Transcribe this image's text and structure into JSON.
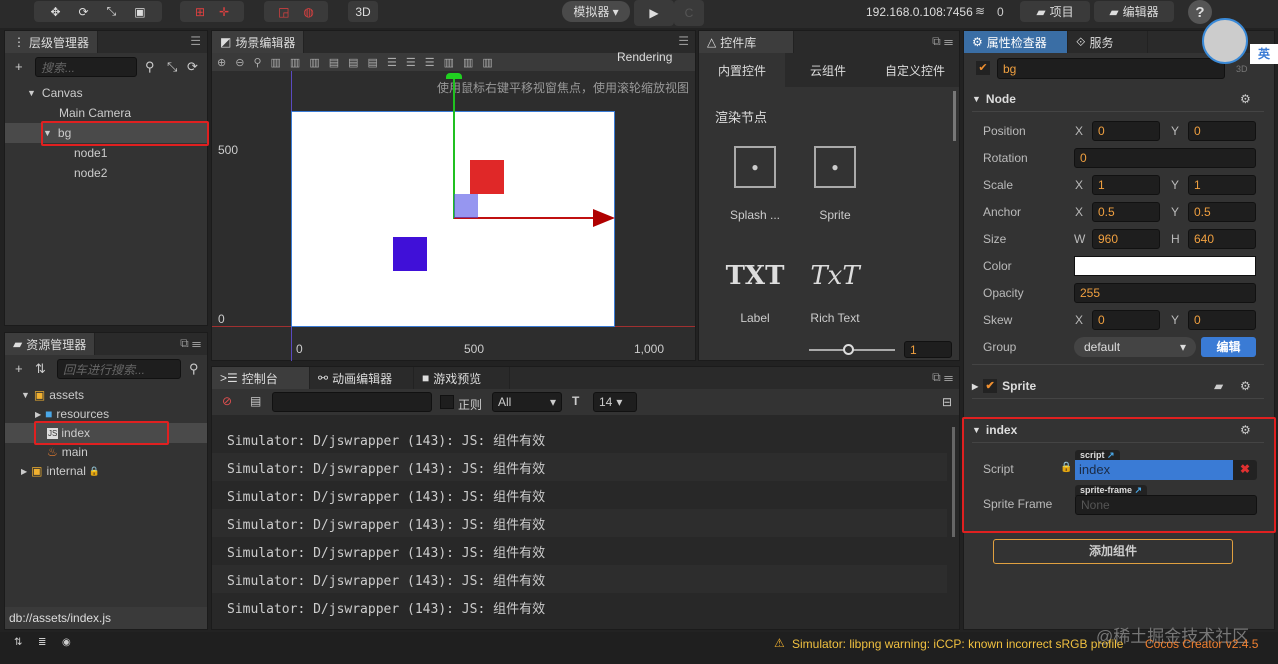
{
  "toolbar": {
    "simulator_label": "模拟器 ▾",
    "mode_3d": "3D",
    "ip": "192.168.0.108:7456",
    "connections": "0",
    "project_btn": "项目",
    "editor_btn": "编辑器",
    "help": "?",
    "ime": "英"
  },
  "hierarchy": {
    "title": "层级管理器",
    "search_placeholder": "搜索...",
    "items": [
      {
        "label": "Canvas"
      },
      {
        "label": "Main Camera"
      },
      {
        "label": "bg"
      },
      {
        "label": "node1"
      },
      {
        "label": "node2"
      }
    ]
  },
  "assets": {
    "title": "资源管理器",
    "search_placeholder": "回车进行搜索...",
    "items": [
      {
        "label": "assets"
      },
      {
        "label": "resources"
      },
      {
        "label": "index"
      },
      {
        "label": "main"
      },
      {
        "label": "internal"
      }
    ],
    "path": "db://assets/index.js"
  },
  "scene": {
    "title": "场景编辑器",
    "rendering": "Rendering",
    "hint": "使用鼠标右键平移视窗焦点，使用滚轮缩放视图",
    "y_ticks": [
      "500",
      "0"
    ],
    "x_ticks": [
      "0",
      "500",
      "1,000"
    ]
  },
  "widgets": {
    "title": "控件库",
    "tabs": [
      "内置控件",
      "云组件",
      "自定义控件"
    ],
    "section": "渲染节点",
    "items": [
      {
        "label": "Splash ...",
        "icon": "sprite-splash-icon"
      },
      {
        "label": "Sprite",
        "icon": "sprite-icon"
      },
      {
        "label": "Label",
        "icon": "TXT"
      },
      {
        "label": "Rich Text",
        "icon": "TxT"
      }
    ],
    "zoom_value": "1"
  },
  "console": {
    "tabs": [
      "控制台",
      "动画编辑器",
      "游戏预览"
    ],
    "regex_label": "正则",
    "filter": "All",
    "font_size": "14",
    "lines": [
      "Simulator: D/jswrapper (143): JS: 组件有效",
      "Simulator: D/jswrapper (143): JS: 组件有效",
      "Simulator: D/jswrapper (143): JS: 组件有效",
      "Simulator: D/jswrapper (143): JS: 组件有效",
      "Simulator: D/jswrapper (143): JS: 组件有效",
      "Simulator: D/jswrapper (143): JS: 组件有效",
      "Simulator: D/jswrapper (143): JS: 组件有效"
    ]
  },
  "inspector": {
    "title": "属性检查器",
    "service_tab": "服务",
    "node_name": "bg",
    "label_3d": "3D",
    "node_section": "Node",
    "position": {
      "label": "Position",
      "x": "0",
      "y": "0"
    },
    "rotation": {
      "label": "Rotation",
      "value": "0"
    },
    "scale": {
      "label": "Scale",
      "x": "1",
      "y": "1"
    },
    "anchor": {
      "label": "Anchor",
      "x": "0.5",
      "y": "0.5"
    },
    "size": {
      "label": "Size",
      "w": "960",
      "h": "640"
    },
    "color": {
      "label": "Color",
      "value": "#ffffff"
    },
    "opacity": {
      "label": "Opacity",
      "value": "255"
    },
    "skew": {
      "label": "Skew",
      "x": "0",
      "y": "0"
    },
    "group": {
      "label": "Group",
      "value": "default",
      "edit": "编辑"
    },
    "axis": {
      "x": "X",
      "y": "Y",
      "w": "W",
      "h": "H"
    },
    "sprite_section": "Sprite",
    "index_section": "index",
    "script": {
      "label": "Script",
      "tag": "script",
      "value": "index"
    },
    "sprite_frame": {
      "label": "Sprite Frame",
      "tag": "sprite-frame",
      "value": "None"
    },
    "add_component": "添加组件"
  },
  "status": {
    "warning": "Simulator: libpng warning: iCCP: known incorrect sRGB profile",
    "version": "Cocos Creator v2.4.5",
    "watermark": "@稀土掘金技术社区"
  },
  "colors": {
    "accent": "#3a7bd5",
    "highlight": "#e02020",
    "orange": "#f0a040"
  }
}
